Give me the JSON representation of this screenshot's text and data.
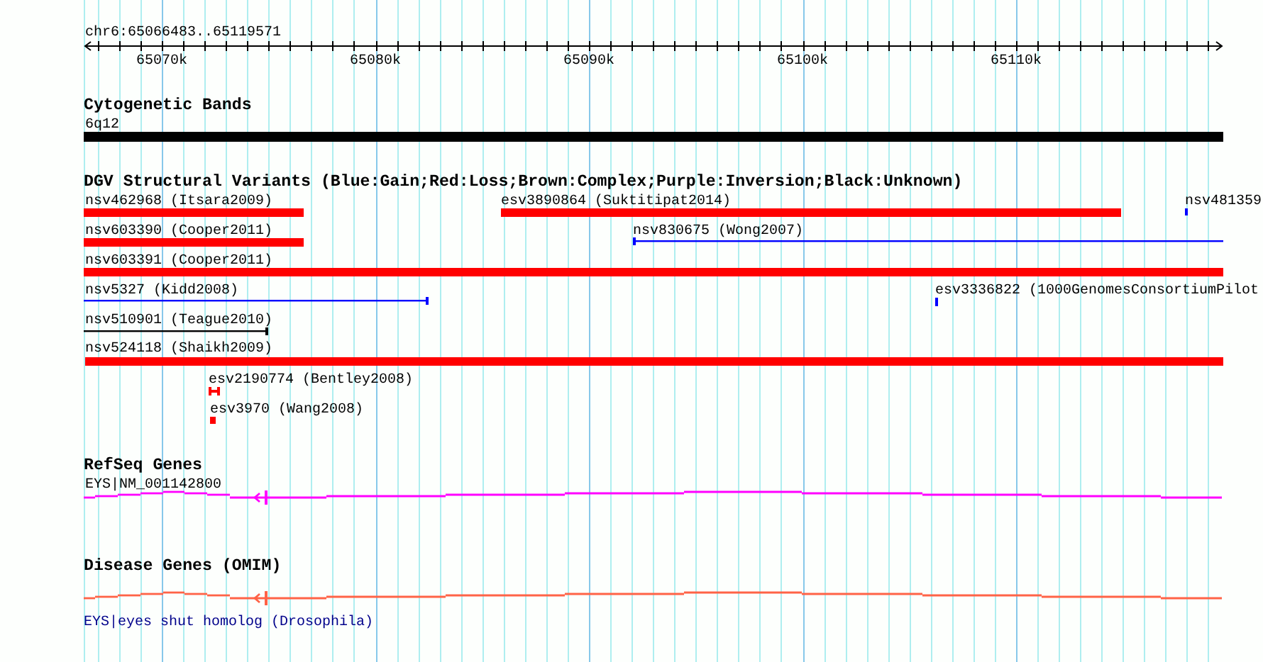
{
  "region": {
    "label": "chr6:65066483..65119571",
    "ticks": [
      "65070k",
      "65080k",
      "65090k",
      "65100k",
      "65110k"
    ]
  },
  "tracks": [
    {
      "kind": "bands",
      "title": "Cytogenetic Bands",
      "features": [
        {
          "label": "6q12"
        }
      ]
    },
    {
      "kind": "variants",
      "title": "DGV Structural Variants (Blue:Gain;Red:Loss;Brown:Complex;Purple:Inversion;Black:Unknown)",
      "features": [
        {
          "label": "nsv462968 (Itsara2009)",
          "kind": "loss"
        },
        {
          "label": "esv3890864 (Suktitipat2014)",
          "kind": "loss"
        },
        {
          "label": "nsv481359",
          "kind": "gain"
        },
        {
          "label": "nsv603390 (Cooper2011)",
          "kind": "loss"
        },
        {
          "label": "nsv830675 (Wong2007)",
          "kind": "gain"
        },
        {
          "label": "nsv603391 (Cooper2011)",
          "kind": "loss"
        },
        {
          "label": "nsv5327 (Kidd2008)",
          "kind": "gain"
        },
        {
          "label": "esv3336822 (1000GenomesConsortiumPilot",
          "kind": "gain"
        },
        {
          "label": "nsv510901 (Teague2010)",
          "kind": "unknown"
        },
        {
          "label": "nsv524118 (Shaikh2009)",
          "kind": "loss"
        },
        {
          "label": "esv2190774 (Bentley2008)",
          "kind": "loss"
        },
        {
          "label": "esv3970 (Wang2008)",
          "kind": "loss"
        }
      ]
    },
    {
      "kind": "gene",
      "title": "RefSeq Genes",
      "features": [
        {
          "label": "EYS|NM_001142800"
        }
      ]
    },
    {
      "kind": "disease",
      "title": "Disease Genes (OMIM)",
      "features": [
        {
          "label": "EYS|eyes shut homolog (Drosophila)"
        }
      ]
    }
  ]
}
